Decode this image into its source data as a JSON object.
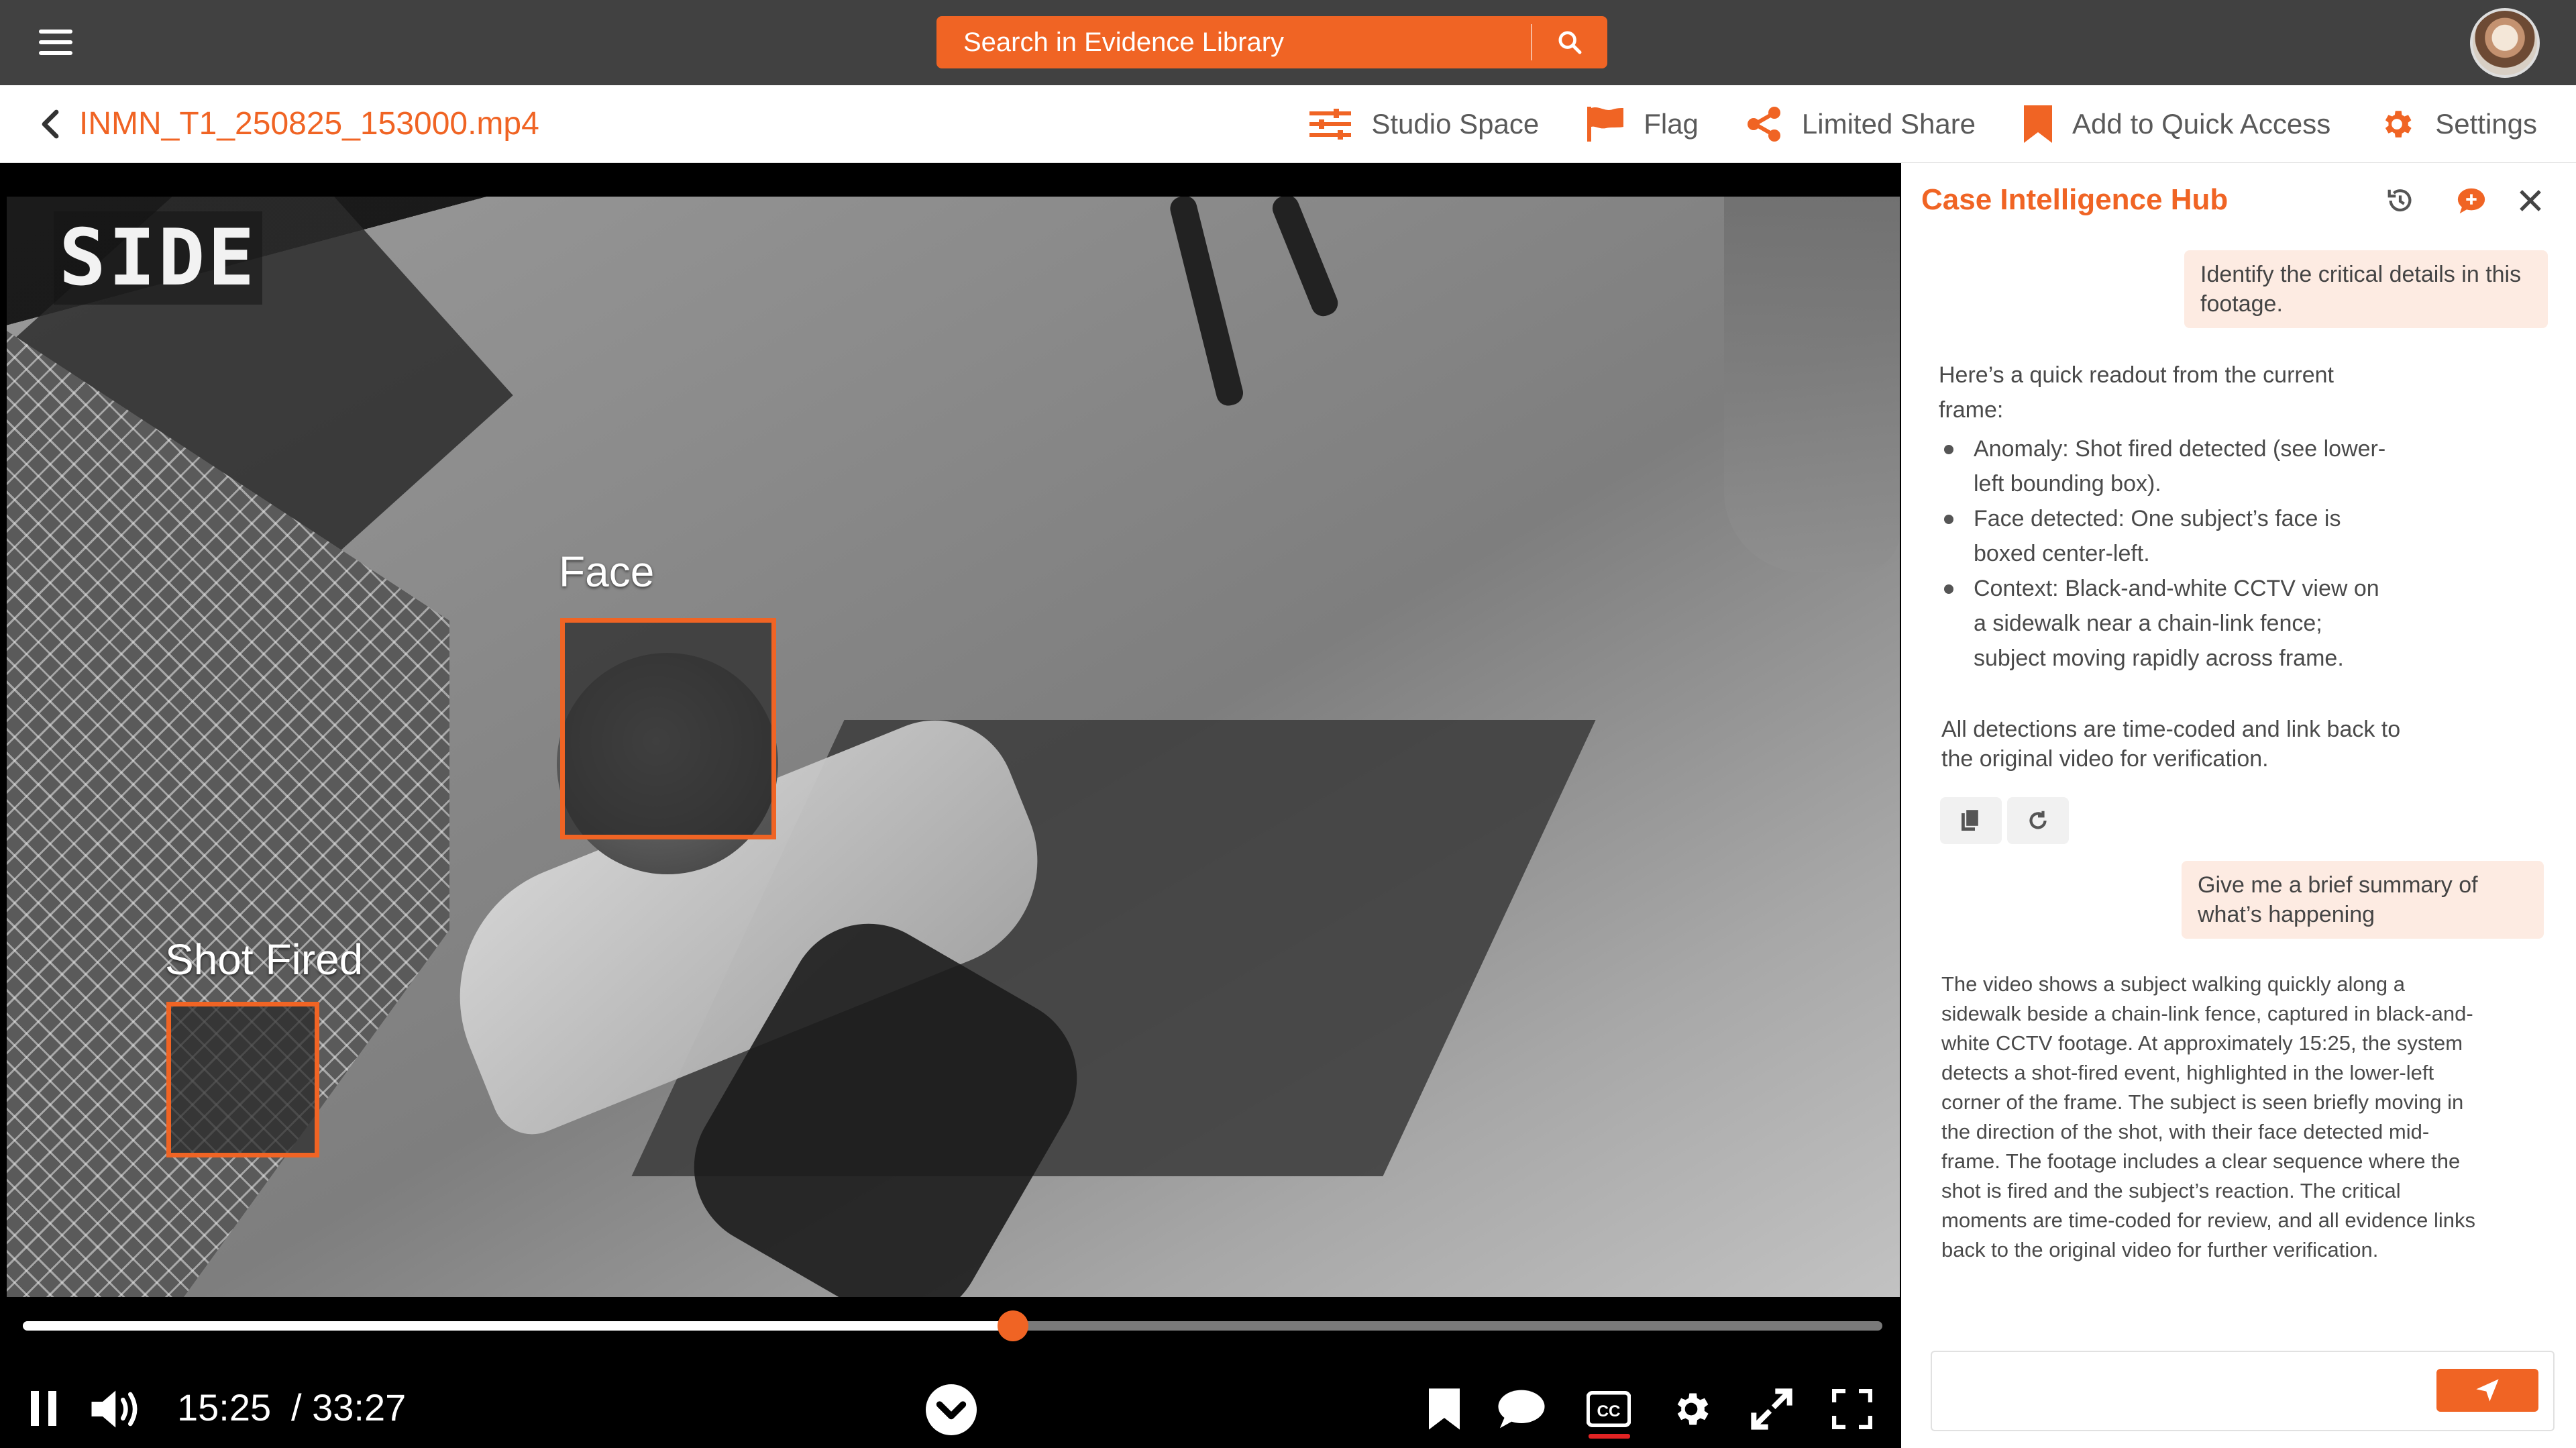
{
  "search": {
    "placeholder": "Search in Evidence Library"
  },
  "header": {
    "file_name": "INMN_T1_250825_153000.mp4",
    "actions": [
      {
        "label": "Studio Space",
        "icon": "sliders-icon"
      },
      {
        "label": "Flag",
        "icon": "flag-icon"
      },
      {
        "label": "Limited Share",
        "icon": "share-icon"
      },
      {
        "label": "Add to Quick Access",
        "icon": "bookmark-icon"
      },
      {
        "label": "Settings",
        "icon": "gear-icon"
      }
    ]
  },
  "video": {
    "overlay_text": "SIDE",
    "detections": [
      {
        "label": "Face"
      },
      {
        "label": "Shot Fired"
      }
    ],
    "current_time": "15:25",
    "duration": "/ 33:27",
    "progress": 0.5325
  },
  "panel": {
    "title": "Case Intelligence Hub",
    "messages": {
      "user_1": "Identify the critical details in this footage.",
      "ai_1_intro": "Here’s a quick readout from the current frame:",
      "ai_1_items": [
        "Anomaly: Shot fired detected (see lower-left bounding box).",
        "Face detected: One subject’s face is boxed center-left.",
        "Context: Black-and-white CCTV view on a sidewalk near a chain-link fence; subject moving rapidly across frame."
      ],
      "ai_1_footer": "All detections are time-coded and link back to the original video for verification.",
      "user_2": "Give me a brief summary of what’s happening",
      "ai_2": "The video shows a subject walking quickly along a sidewalk beside a chain-link fence, captured in black-and-white CCTV footage. At approximately 15:25, the system detects a shot-fired event, highlighted in the lower-left corner of the frame. The subject is seen briefly moving in the direction of the shot, with their face detected mid-frame. The footage includes a clear sequence where the shot is fired and the subject’s reaction. The critical moments are time-coded for review, and all evidence links back to the original video for further verification."
    },
    "input_placeholder": ""
  },
  "colors": {
    "accent": "#f06424",
    "topbar": "#414141",
    "cc_indicator": "#e12323"
  }
}
